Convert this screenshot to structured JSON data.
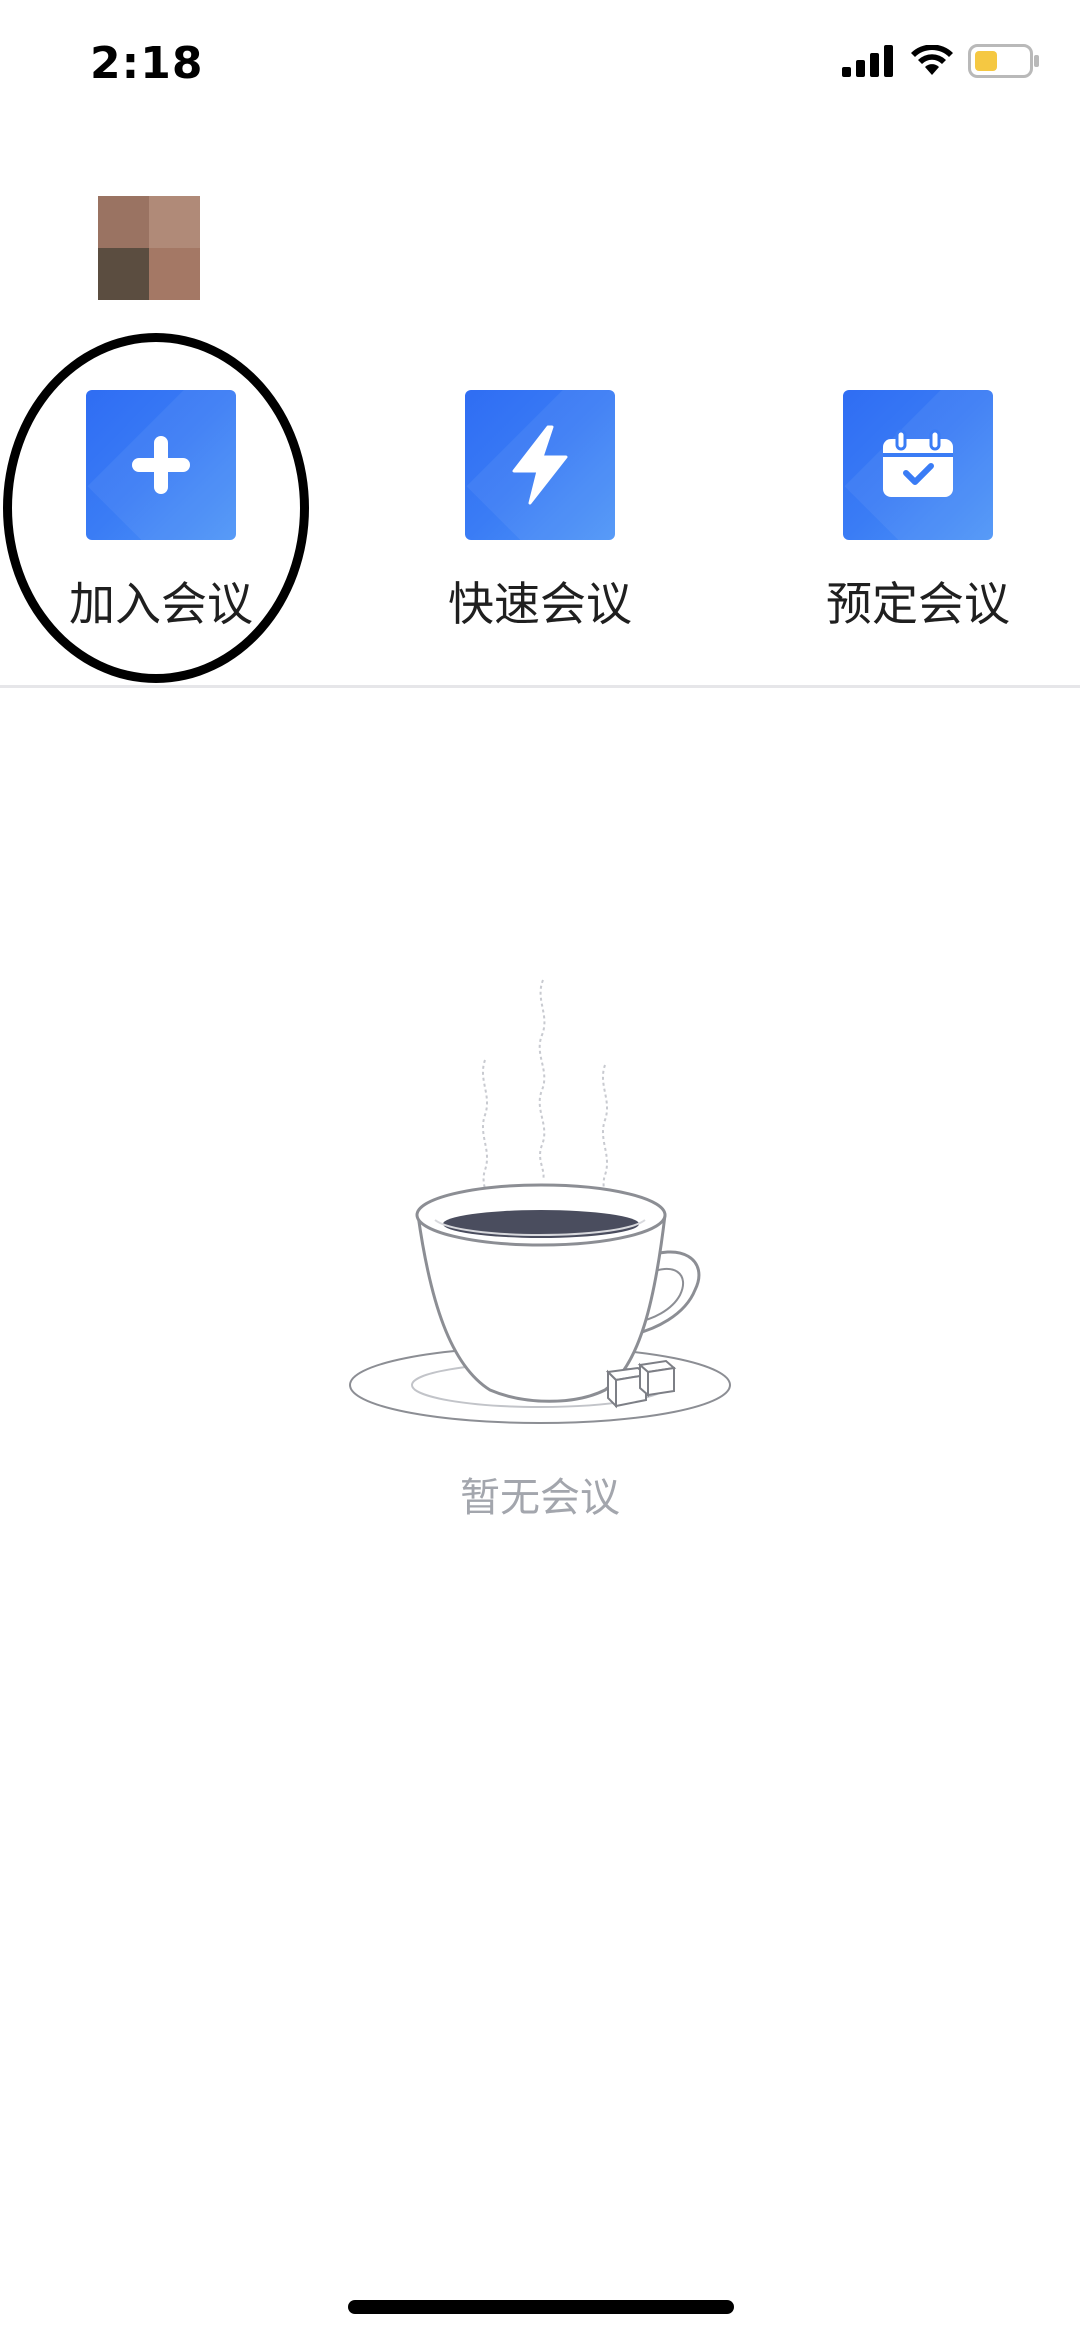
{
  "status_bar": {
    "time": "2:18",
    "battery_color": "#f5c842"
  },
  "avatar": {
    "colors": [
      "#9a7362",
      "#b08a78",
      "#5b4d40",
      "#a47865"
    ]
  },
  "actions": [
    {
      "label": "加入会议",
      "icon": "plus-icon"
    },
    {
      "label": "快速会议",
      "icon": "lightning-icon"
    },
    {
      "label": "预定会议",
      "icon": "calendar-check-icon"
    }
  ],
  "empty_state": {
    "text": "暂无会议",
    "icon": "coffee-cup-illustration"
  },
  "colors": {
    "accent": "#3a7cf5",
    "empty_text": "#a3a6ad"
  }
}
